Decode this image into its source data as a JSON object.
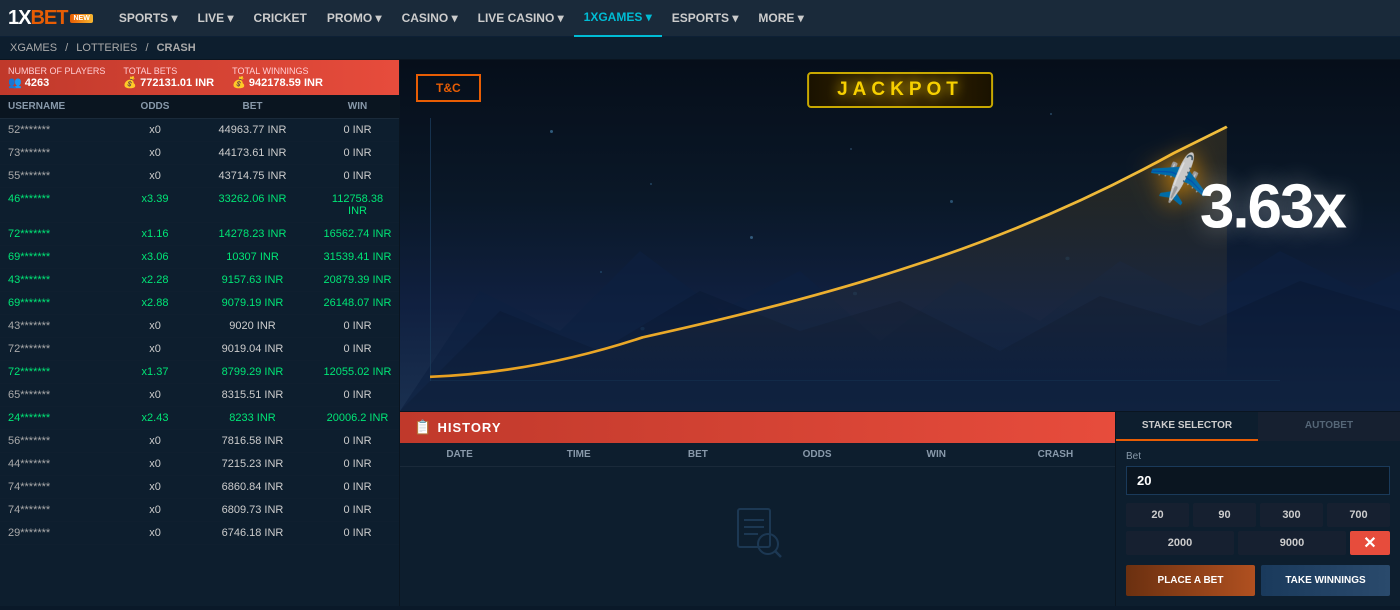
{
  "nav": {
    "logo": "1XBET",
    "new_badge": "NEW",
    "items": [
      {
        "label": "SPORTS",
        "id": "sports",
        "has_arrow": true,
        "active": false
      },
      {
        "label": "LIVE",
        "id": "live",
        "has_arrow": true,
        "active": false
      },
      {
        "label": "CRICKET",
        "id": "cricket",
        "has_arrow": false,
        "active": false
      },
      {
        "label": "PROMO",
        "id": "promo",
        "has_arrow": true,
        "active": false
      },
      {
        "label": "CASINO",
        "id": "casino",
        "has_arrow": true,
        "active": false
      },
      {
        "label": "LIVE CASINO",
        "id": "live-casino",
        "has_arrow": true,
        "active": false
      },
      {
        "label": "1XGAMES",
        "id": "1xgames",
        "has_arrow": true,
        "active": true
      },
      {
        "label": "ESPORTS",
        "id": "esports",
        "has_arrow": true,
        "active": false
      },
      {
        "label": "MORE",
        "id": "more",
        "has_arrow": true,
        "active": false
      }
    ]
  },
  "breadcrumb": {
    "items": [
      "XGAMES",
      "LOTTERIES",
      "CRASH"
    ]
  },
  "stats": {
    "players_label": "Number of players",
    "players_value": "4263",
    "total_bets_label": "Total bets",
    "total_bets_value": "772131.01 INR",
    "total_winnings_label": "Total winnings",
    "total_winnings_value": "942178.59 INR"
  },
  "table": {
    "headers": [
      "USERNAME",
      "ODDS",
      "BET",
      "WIN"
    ],
    "rows": [
      {
        "username": "52*******",
        "odds": "x0",
        "bet": "44963.77 INR",
        "win": "0 INR",
        "win_color": false
      },
      {
        "username": "73*******",
        "odds": "x0",
        "bet": "44173.61 INR",
        "win": "0 INR",
        "win_color": false
      },
      {
        "username": "55*******",
        "odds": "x0",
        "bet": "43714.75 INR",
        "win": "0 INR",
        "win_color": false
      },
      {
        "username": "46*******",
        "odds": "x3.39",
        "bet": "33262.06 INR",
        "win": "112758.38 INR",
        "win_color": true
      },
      {
        "username": "72*******",
        "odds": "x1.16",
        "bet": "14278.23 INR",
        "win": "16562.74 INR",
        "win_color": true
      },
      {
        "username": "69*******",
        "odds": "x3.06",
        "bet": "10307 INR",
        "win": "31539.41 INR",
        "win_color": true
      },
      {
        "username": "43*******",
        "odds": "x2.28",
        "bet": "9157.63 INR",
        "win": "20879.39 INR",
        "win_color": true
      },
      {
        "username": "69*******",
        "odds": "x2.88",
        "bet": "9079.19 INR",
        "win": "26148.07 INR",
        "win_color": true
      },
      {
        "username": "43*******",
        "odds": "x0",
        "bet": "9020 INR",
        "win": "0 INR",
        "win_color": false
      },
      {
        "username": "72*******",
        "odds": "x0",
        "bet": "9019.04 INR",
        "win": "0 INR",
        "win_color": false
      },
      {
        "username": "72*******",
        "odds": "x1.37",
        "bet": "8799.29 INR",
        "win": "12055.02 INR",
        "win_color": true
      },
      {
        "username": "65*******",
        "odds": "x0",
        "bet": "8315.51 INR",
        "win": "0 INR",
        "win_color": false
      },
      {
        "username": "24*******",
        "odds": "x2.43",
        "bet": "8233 INR",
        "win": "20006.2 INR",
        "win_color": true
      },
      {
        "username": "56*******",
        "odds": "x0",
        "bet": "7816.58 INR",
        "win": "0 INR",
        "win_color": false
      },
      {
        "username": "44*******",
        "odds": "x0",
        "bet": "7215.23 INR",
        "win": "0 INR",
        "win_color": false
      },
      {
        "username": "74*******",
        "odds": "x0",
        "bet": "6860.84 INR",
        "win": "0 INR",
        "win_color": false
      },
      {
        "username": "74*******",
        "odds": "x0",
        "bet": "6809.73 INR",
        "win": "0 INR",
        "win_color": false
      },
      {
        "username": "29*******",
        "odds": "x0",
        "bet": "6746.18 INR",
        "win": "0 INR",
        "win_color": false
      }
    ]
  },
  "game": {
    "jackpot_label": "JACKPOT",
    "tc_label": "T&C",
    "multiplier": "3.63x"
  },
  "history": {
    "title": "HISTORY",
    "icon": "📋",
    "columns": [
      "DATE",
      "TIME",
      "BET",
      "ODDS",
      "WIN",
      "CRASH"
    ]
  },
  "stake": {
    "selector_label": "STAKE SELECTOR",
    "autobet_label": "AUTOBET",
    "bet_label": "Bet",
    "bet_value": "20",
    "quick_amounts": [
      "20",
      "90",
      "300",
      "700"
    ],
    "quick_amounts2": [
      "2000",
      "9000"
    ],
    "place_bet_label": "PLACE A BET",
    "take_winnings_label": "TAKE WINNINGS"
  }
}
